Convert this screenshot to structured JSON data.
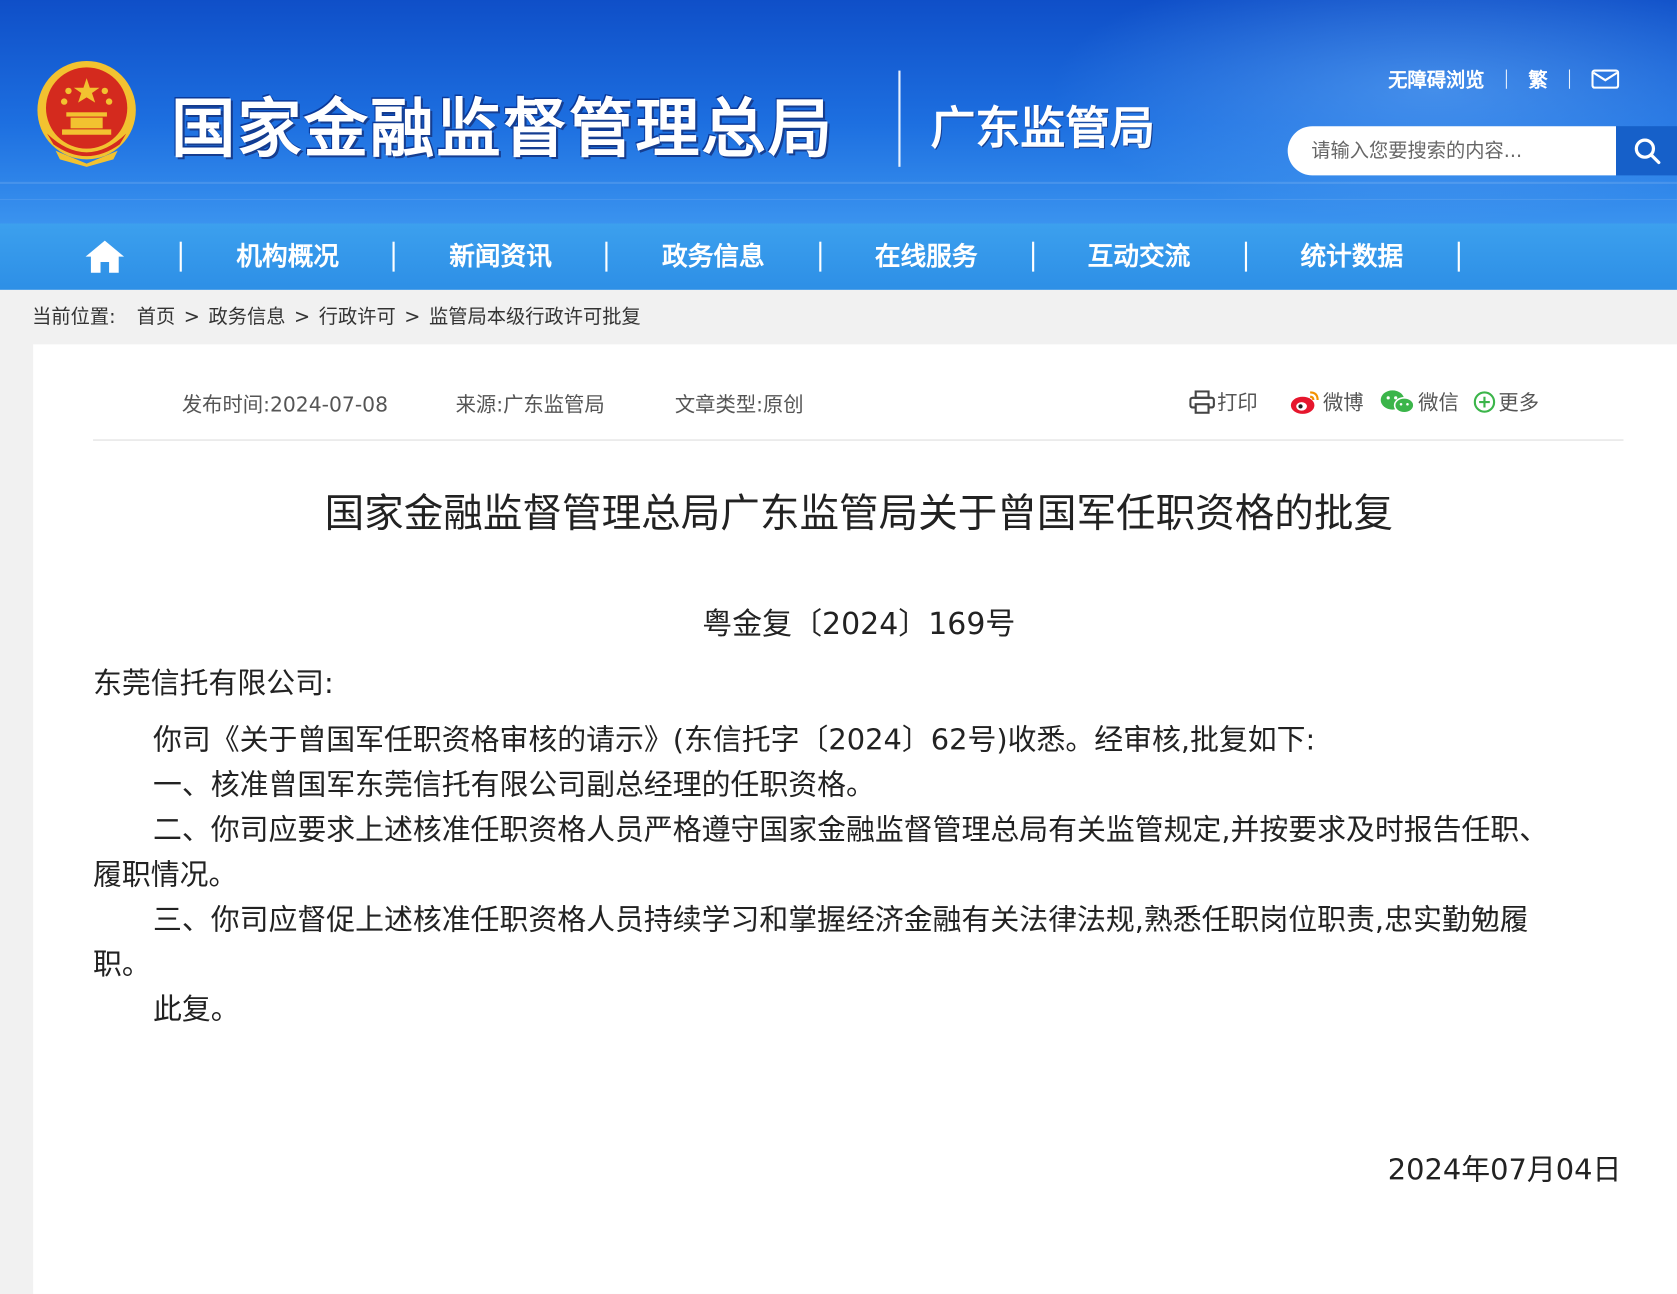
{
  "header": {
    "org_title": "国家金融监督管理总局",
    "sub_title": "广东监管局",
    "accessibility_link": "无障碍浏览",
    "traditional_link": "繁",
    "search_placeholder": "请输入您要搜索的内容..."
  },
  "nav": {
    "items": [
      "机构概况",
      "新闻资讯",
      "政务信息",
      "在线服务",
      "互动交流",
      "统计数据"
    ]
  },
  "breadcrumb": {
    "label": "当前位置:",
    "items": [
      "首页",
      "政务信息",
      "行政许可",
      "监管局本级行政许可批复"
    ],
    "separator": ">"
  },
  "meta": {
    "publish_time": "发布时间:2024-07-08",
    "source": "来源:广东监管局",
    "type": "文章类型:原创"
  },
  "share": {
    "print": "打印",
    "weibo": "微博",
    "wechat": "微信",
    "more": "更多"
  },
  "article": {
    "title": "国家金融监督管理总局广东监管局关于曾国军任职资格的批复",
    "doc_number": "粤金复〔2024〕169号",
    "addressee": "东莞信托有限公司:",
    "p1": "你司《关于曾国军任职资格审核的请示》(东信托字〔2024〕62号)收悉。经审核,批复如下:",
    "p2": "一、核准曾国军东莞信托有限公司副总经理的任职资格。",
    "p3_line1": "二、你司应要求上述核准任职资格人员严格遵守国家金融监督管理总局有关监管规定,并按要求及时报告任职、",
    "p3_line2": "履职情况。",
    "p4_line1": "三、你司应督促上述核准任职资格人员持续学习和掌握经济金融有关法律法规,熟悉任职岗位职责,忠实勤勉履",
    "p4_line2": "职。",
    "closing": "此复。",
    "date": "2024年07月04日"
  },
  "colors": {
    "header_blue": "#1d6fe0",
    "nav_blue": "#2d8fe6",
    "emblem_red": "#d42a1e",
    "emblem_gold": "#f2c230"
  }
}
